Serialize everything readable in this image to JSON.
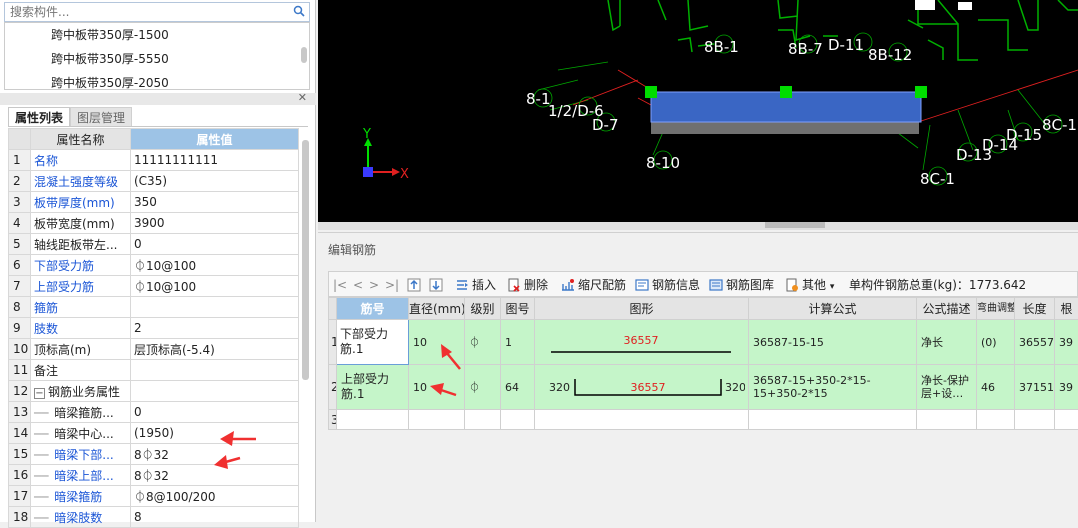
{
  "search": {
    "placeholder": "搜索构件..."
  },
  "component_list": [
    "跨中板带350厚-1500",
    "跨中板带350厚-5550",
    "跨中板带350厚-2050"
  ],
  "panel_tabs": {
    "active": "属性列表",
    "inactive": "图层管理"
  },
  "prop_headers": {
    "num": "",
    "name": "属性名称",
    "value": "属性值"
  },
  "properties": [
    {
      "num": "1",
      "name": "名称",
      "value": "11111111111",
      "blue": true
    },
    {
      "num": "2",
      "name": "混凝土强度等级",
      "value": "(C35)",
      "blue": true
    },
    {
      "num": "3",
      "name": "板带厚度(mm)",
      "value": "350",
      "blue": true
    },
    {
      "num": "4",
      "name": "板带宽度(mm)",
      "value": "3900",
      "blue": false
    },
    {
      "num": "5",
      "name": "轴线距板带左...",
      "value": "0",
      "blue": false
    },
    {
      "num": "6",
      "name": "下部受力筋",
      "value": "⏀10@100",
      "blue": true
    },
    {
      "num": "7",
      "name": "上部受力筋",
      "value": "⏀10@100",
      "blue": true
    },
    {
      "num": "8",
      "name": "箍筋",
      "value": "",
      "blue": true
    },
    {
      "num": "9",
      "name": "肢数",
      "value": "2",
      "blue": true
    },
    {
      "num": "10",
      "name": "顶标高(m)",
      "value": "层顶标高(-5.4)",
      "blue": false
    },
    {
      "num": "11",
      "name": "备注",
      "value": "",
      "blue": false
    },
    {
      "num": "12",
      "name": "钢筋业务属性",
      "value": "",
      "blue": false,
      "group": true
    },
    {
      "num": "13",
      "name": "暗梁箍筋...",
      "value": "0",
      "blue": false,
      "child": true
    },
    {
      "num": "14",
      "name": "暗梁中心...",
      "value": "(1950)",
      "blue": false,
      "child": true
    },
    {
      "num": "15",
      "name": "暗梁下部...",
      "value": "8⏀32",
      "blue": true,
      "child": true
    },
    {
      "num": "16",
      "name": "暗梁上部...",
      "value": "8⏀32",
      "blue": true,
      "child": true
    },
    {
      "num": "17",
      "name": "暗梁箍筋",
      "value": "⏀8@100/200",
      "blue": true,
      "child": true
    },
    {
      "num": "18",
      "name": "暗梁肢数",
      "value": "8",
      "blue": true,
      "child": true
    }
  ],
  "canvas": {
    "labels": [
      "8B-1",
      "8B-7",
      "D-11",
      "8B-12",
      "8-1",
      "1/2/D-6",
      "D-7",
      "8-10",
      "8C-1",
      "D-13",
      "D-14",
      "D-15",
      "8C-1"
    ],
    "axis_y": "Y",
    "axis_x": "X",
    "colors": {
      "beam_fill": "#3a66c4",
      "handle": "#00dd00",
      "axis_line": "#e02020",
      "grid_green": "#00aa00"
    }
  },
  "edit_panel": {
    "title": "编辑钢筋",
    "nav": [
      "|<",
      "<",
      ">",
      ">|"
    ],
    "toolbar": {
      "insert": "插入",
      "delete": "删除",
      "scale": "缩尺配筋",
      "info": "钢筋信息",
      "library": "钢筋图库",
      "other": "其他",
      "total": "单构件钢筋总重(kg)：1773.642"
    },
    "headers": [
      "",
      "筋号",
      "直径(mm)",
      "级别",
      "图号",
      "图形",
      "计算公式",
      "公式描述",
      "弯曲调整",
      "长度",
      "根"
    ],
    "rows": [
      {
        "rn": "1",
        "name": "下部受力筋.1",
        "dia": "10",
        "grade": "⏀",
        "fig": "1",
        "shape_left": "",
        "shape_mid": "36557",
        "shape_right": "",
        "formula": "36587-15-15",
        "desc": "净长",
        "bend": "(0)",
        "length": "36557",
        "count": "39"
      },
      {
        "rn": "2",
        "name": "上部受力筋.1",
        "dia": "10",
        "grade": "⏀",
        "fig": "64",
        "shape_left": "320",
        "shape_mid": "36557",
        "shape_right": "320",
        "formula": "36587-15+350-2*15-15+350-2*15",
        "desc": "净长-保护层+设…",
        "bend": "46",
        "length": "37151",
        "count": "39"
      }
    ],
    "empty_row": "3"
  }
}
